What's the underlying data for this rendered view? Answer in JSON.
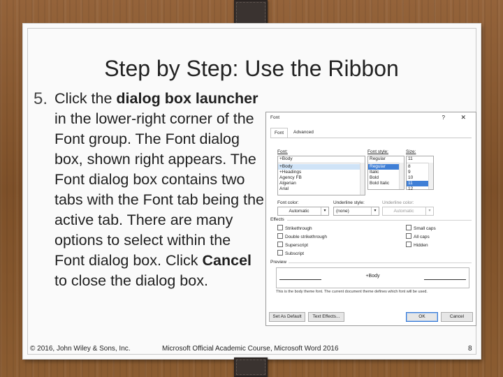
{
  "slide": {
    "title": "Step by Step: Use the Ribbon",
    "step_number": "5.",
    "text": {
      "t1": "Click the ",
      "b1": "dialog box launcher",
      "t2": " in the lower-right corner of the Font group. The Font dialog box, shown right appears. The Font dialog box contains two tabs with the Font tab being the active tab. There are many options to select within the Font dialog box. Click ",
      "b2": "Cancel",
      "t3": " to close the dialog box."
    },
    "footer": {
      "copyright": "© 2016, John Wiley & Sons, Inc.",
      "course": "Microsoft Official Academic Course, Microsoft Word 2016",
      "page": "8"
    }
  },
  "dialog": {
    "title": "Font",
    "help": "?",
    "close": "✕",
    "tabs": [
      "Font",
      "Advanced"
    ],
    "font_label": "Font:",
    "font_value": "+Body",
    "font_list": [
      "+Body",
      "+Headings",
      "Agency FB",
      "Algerian",
      "Arial"
    ],
    "style_label": "Font style:",
    "style_value": "Regular",
    "style_list": [
      "Regular",
      "Italic",
      "Bold",
      "Bold Italic"
    ],
    "size_label": "Size:",
    "size_value": "11",
    "size_list": [
      "8",
      "9",
      "10",
      "11",
      "12"
    ],
    "font_color_label": "Font color:",
    "font_color_value": "Automatic",
    "underline_style_label": "Underline style:",
    "underline_style_value": "(none)",
    "underline_color_label": "Underline color:",
    "underline_color_value": "Automatic",
    "effects_label": "Effects",
    "effects_left": [
      "Strikethrough",
      "Double strikethrough",
      "Superscript",
      "Subscript"
    ],
    "effects_right": [
      "Small caps",
      "All caps",
      "Hidden"
    ],
    "preview_label": "Preview",
    "preview_text": "+Body",
    "preview_desc": "This is the body theme font. The current document theme defines which font will be used.",
    "set_default": "Set As Default",
    "text_effects": "Text Effects...",
    "ok": "OK",
    "cancel": "Cancel"
  }
}
